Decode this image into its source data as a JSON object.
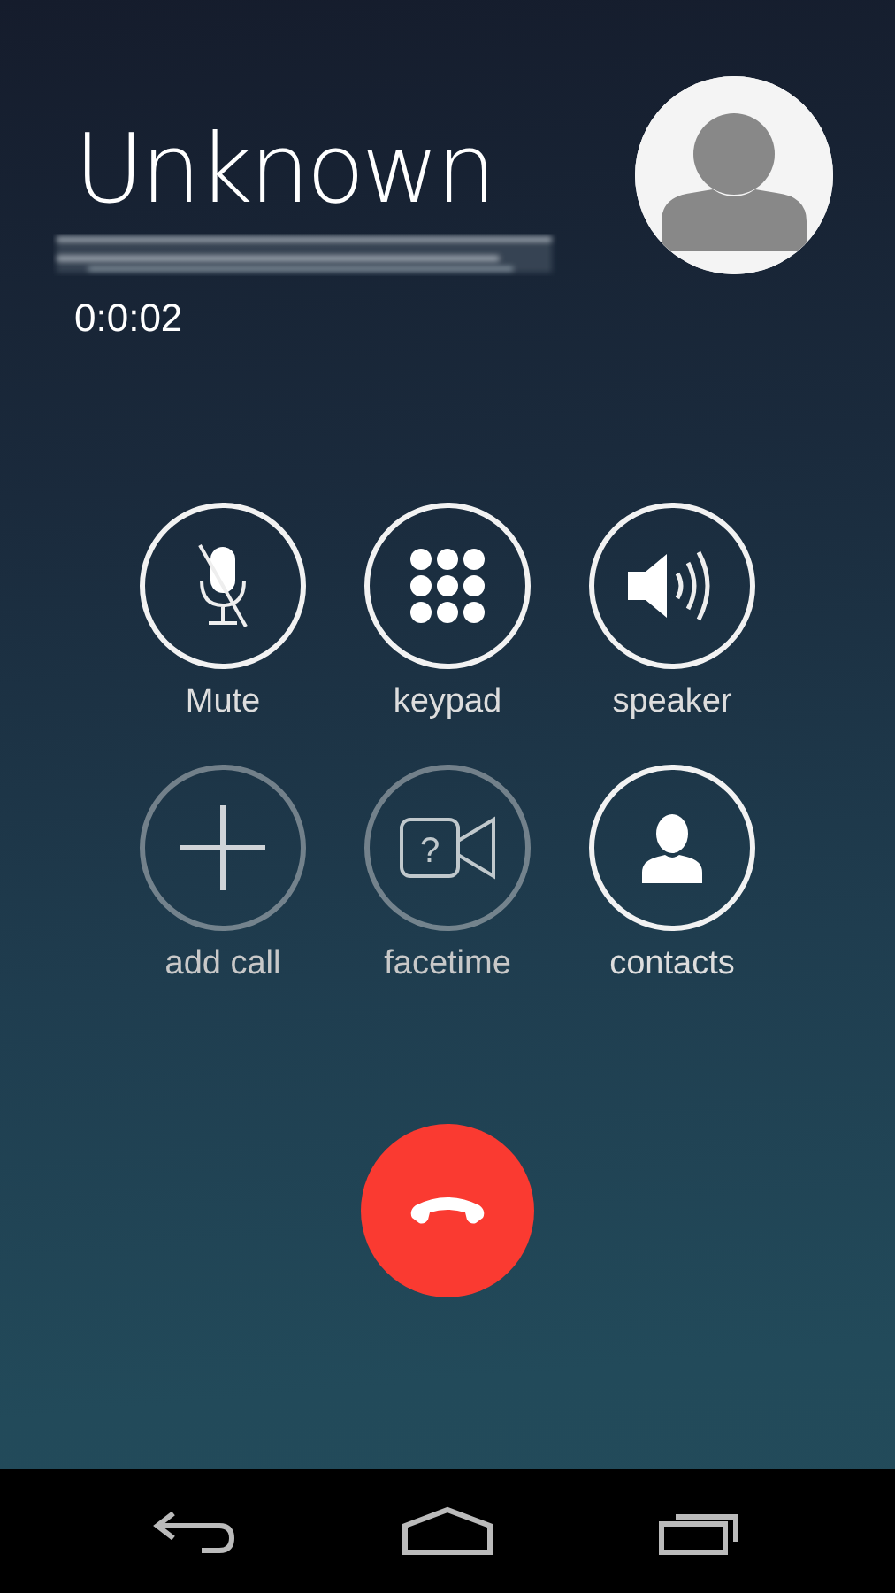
{
  "caller": {
    "name": "Unknown",
    "number_hidden": true,
    "duration": "0:0:02"
  },
  "controls": [
    {
      "kind": "mute",
      "label": "Mute",
      "disabled": false
    },
    {
      "kind": "keypad",
      "label": "keypad",
      "disabled": false
    },
    {
      "kind": "speaker",
      "label": "speaker",
      "disabled": false
    },
    {
      "kind": "add",
      "label": "add call",
      "disabled": true
    },
    {
      "kind": "video",
      "label": "facetime",
      "disabled": true,
      "glyph": "?"
    },
    {
      "kind": "contacts",
      "label": "contacts",
      "disabled": false
    }
  ],
  "nav_bar": [
    {
      "kind": "back"
    },
    {
      "kind": "home"
    },
    {
      "kind": "recents"
    }
  ]
}
